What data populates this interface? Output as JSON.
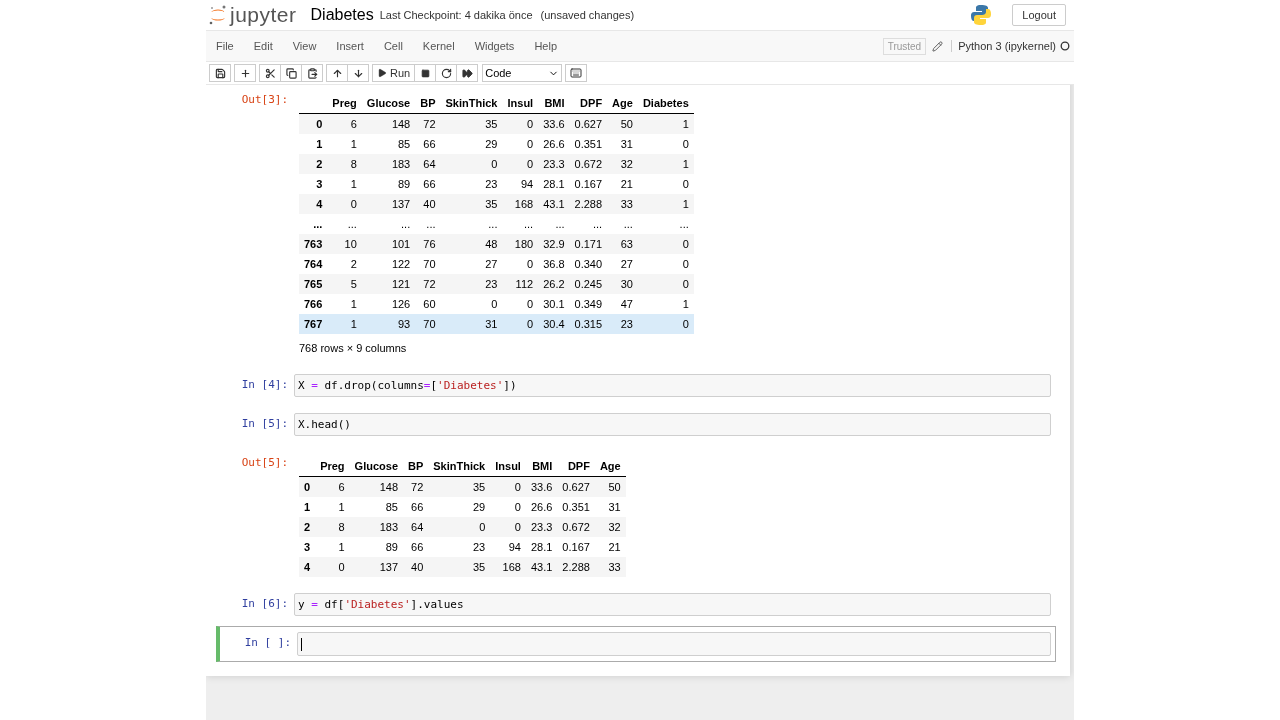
{
  "header": {
    "logo_text": "jupyter",
    "notebook_name": "Diabetes",
    "checkpoint": "Last Checkpoint: 4 dakika önce",
    "autosave": "(unsaved changes)",
    "logout": "Logout"
  },
  "menu": [
    "File",
    "Edit",
    "View",
    "Insert",
    "Cell",
    "Kernel",
    "Widgets",
    "Help"
  ],
  "notebook_status": {
    "trusted": "Trusted",
    "kernel": "Python 3 (ipykernel)",
    "kernel_busy": false
  },
  "toolbar": {
    "run": "Run",
    "cell_type": "Code"
  },
  "cells": [
    {
      "kind": "output",
      "prompt": "Out[3]:",
      "columns": [
        "Preg",
        "Glucose",
        "BP",
        "SkinThick",
        "Insul",
        "BMI",
        "DPF",
        "Age",
        "Diabetes"
      ],
      "rows": [
        {
          "index": "0",
          "values": [
            "6",
            "148",
            "72",
            "35",
            "0",
            "33.6",
            "0.627",
            "50",
            "1"
          ],
          "hovered": false
        },
        {
          "index": "1",
          "values": [
            "1",
            "85",
            "66",
            "29",
            "0",
            "26.6",
            "0.351",
            "31",
            "0"
          ],
          "hovered": false
        },
        {
          "index": "2",
          "values": [
            "8",
            "183",
            "64",
            "0",
            "0",
            "23.3",
            "0.672",
            "32",
            "1"
          ],
          "hovered": false
        },
        {
          "index": "3",
          "values": [
            "1",
            "89",
            "66",
            "23",
            "94",
            "28.1",
            "0.167",
            "21",
            "0"
          ],
          "hovered": false
        },
        {
          "index": "4",
          "values": [
            "0",
            "137",
            "40",
            "35",
            "168",
            "43.1",
            "2.288",
            "33",
            "1"
          ],
          "hovered": false
        },
        {
          "index": "...",
          "values": [
            "...",
            "...",
            "...",
            "...",
            "...",
            "...",
            "...",
            "...",
            "..."
          ],
          "hovered": false
        },
        {
          "index": "763",
          "values": [
            "10",
            "101",
            "76",
            "48",
            "180",
            "32.9",
            "0.171",
            "63",
            "0"
          ],
          "hovered": false
        },
        {
          "index": "764",
          "values": [
            "2",
            "122",
            "70",
            "27",
            "0",
            "36.8",
            "0.340",
            "27",
            "0"
          ],
          "hovered": false
        },
        {
          "index": "765",
          "values": [
            "5",
            "121",
            "72",
            "23",
            "112",
            "26.2",
            "0.245",
            "30",
            "0"
          ],
          "hovered": false
        },
        {
          "index": "766",
          "values": [
            "1",
            "126",
            "60",
            "0",
            "0",
            "30.1",
            "0.349",
            "47",
            "1"
          ],
          "hovered": false
        },
        {
          "index": "767",
          "values": [
            "1",
            "93",
            "70",
            "31",
            "0",
            "30.4",
            "0.315",
            "23",
            "0"
          ],
          "hovered": true
        }
      ],
      "footer": "768 rows × 9 columns"
    },
    {
      "kind": "input",
      "prompt": "In [4]:",
      "selected": false,
      "code": [
        {
          "text": "X ",
          "kind": "plain"
        },
        {
          "text": "=",
          "kind": "op"
        },
        {
          "text": " df.drop(columns",
          "kind": "plain"
        },
        {
          "text": "=",
          "kind": "op"
        },
        {
          "text": "[",
          "kind": "plain"
        },
        {
          "text": "'Diabetes'",
          "kind": "str"
        },
        {
          "text": "])",
          "kind": "plain"
        }
      ]
    },
    {
      "kind": "input",
      "prompt": "In [5]:",
      "selected": false,
      "code": [
        {
          "text": "X.head()",
          "kind": "plain"
        }
      ]
    },
    {
      "kind": "output",
      "prompt": "Out[5]:",
      "columns": [
        "Preg",
        "Glucose",
        "BP",
        "SkinThick",
        "Insul",
        "BMI",
        "DPF",
        "Age"
      ],
      "rows": [
        {
          "index": "0",
          "values": [
            "6",
            "148",
            "72",
            "35",
            "0",
            "33.6",
            "0.627",
            "50"
          ],
          "hovered": false
        },
        {
          "index": "1",
          "values": [
            "1",
            "85",
            "66",
            "29",
            "0",
            "26.6",
            "0.351",
            "31"
          ],
          "hovered": false
        },
        {
          "index": "2",
          "values": [
            "8",
            "183",
            "64",
            "0",
            "0",
            "23.3",
            "0.672",
            "32"
          ],
          "hovered": false
        },
        {
          "index": "3",
          "values": [
            "1",
            "89",
            "66",
            "23",
            "94",
            "28.1",
            "0.167",
            "21"
          ],
          "hovered": false
        },
        {
          "index": "4",
          "values": [
            "0",
            "137",
            "40",
            "35",
            "168",
            "43.1",
            "2.288",
            "33"
          ],
          "hovered": false
        }
      ]
    },
    {
      "kind": "input",
      "prompt": "In [6]:",
      "selected": false,
      "code": [
        {
          "text": "y ",
          "kind": "plain"
        },
        {
          "text": "=",
          "kind": "op"
        },
        {
          "text": " df[",
          "kind": "plain"
        },
        {
          "text": "'Diabetes'",
          "kind": "str"
        },
        {
          "text": "].values",
          "kind": "plain"
        }
      ]
    },
    {
      "kind": "input",
      "prompt": "In [ ]:",
      "selected": true
    }
  ]
}
